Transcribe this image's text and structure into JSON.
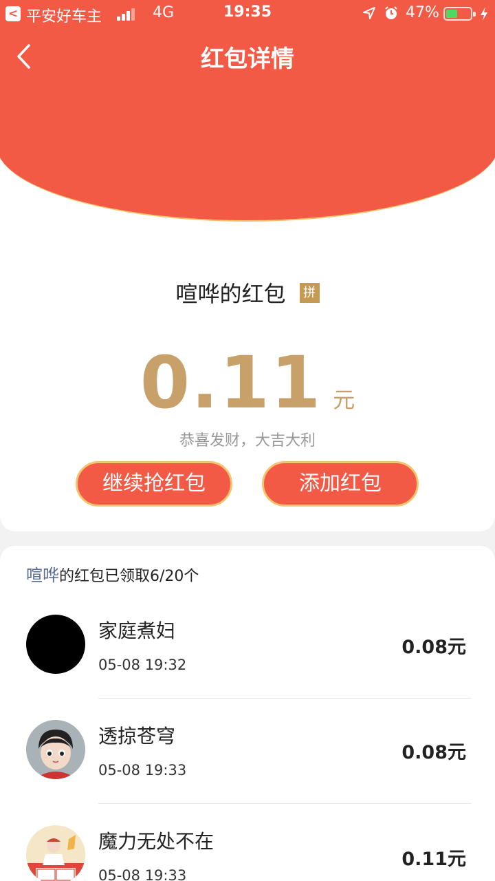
{
  "status_bar": {
    "back_app_glyph": "<",
    "carrier": "平安好车主",
    "network": "4G",
    "time": "19:35",
    "battery_percent": "47%",
    "battery_level": 0.47,
    "icons": [
      "signal-icon",
      "location-icon",
      "alarm-icon",
      "battery-icon",
      "charging-icon"
    ]
  },
  "nav": {
    "title": "红包详情",
    "back_icon": "chevron-left-icon"
  },
  "envelope": {
    "sender_name": "喧哗的红包",
    "badge": "拼",
    "amount": "0.11",
    "unit": "元",
    "greeting": "恭喜发财，大吉大利",
    "buttons": {
      "continue": "继续抢红包",
      "add": "添加红包"
    }
  },
  "claims": {
    "summary_highlight": "喧哗",
    "summary_text": "的红包已领取6/20个",
    "items": [
      {
        "name": "家庭煮妇",
        "time": "05-08 19:32",
        "amount": "0.08元"
      },
      {
        "name": "透掠苍穹",
        "time": "05-08 19:33",
        "amount": "0.08元"
      },
      {
        "name": "魔力无处不在",
        "time": "05-08 19:33",
        "amount": "0.11元"
      }
    ]
  },
  "colors": {
    "header_red": "#f25a45",
    "gold": "#c8a06a",
    "button_border": "#f5c46e",
    "summary_highlight": "#5a6d96"
  }
}
